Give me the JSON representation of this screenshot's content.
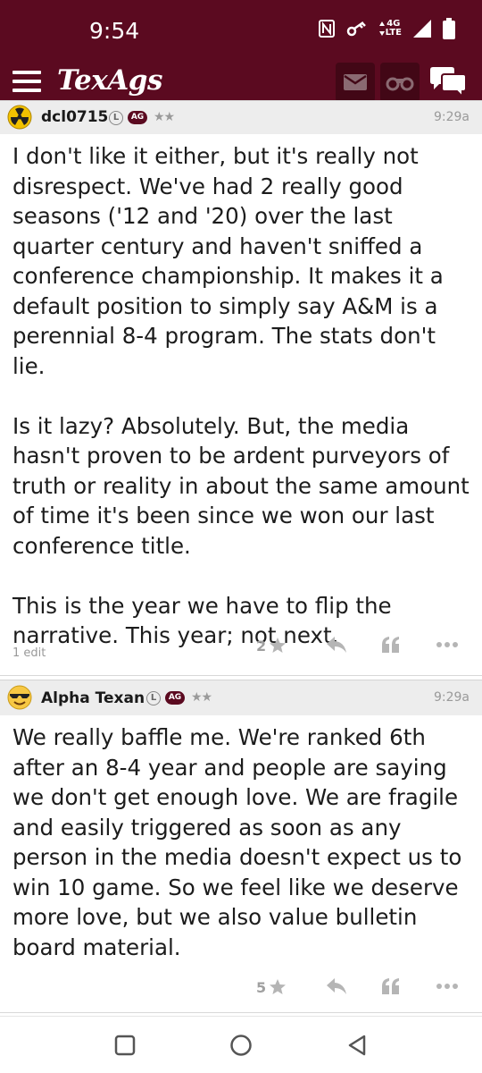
{
  "status_bar": {
    "time": "9:54",
    "network_top": "4G",
    "network_bottom": "LTE",
    "icons": [
      "nfc-icon",
      "vpn-key-icon",
      "signal-icon",
      "battery-icon"
    ]
  },
  "header": {
    "logo_text": "TexAgs",
    "buttons": [
      "mail-icon",
      "binoculars-icon",
      "chat-icon"
    ],
    "brand_color": "#5b0a20"
  },
  "posts": [
    {
      "username": "dcl0715",
      "badge_l": "L",
      "badge_ag": "AG",
      "stars": "★★",
      "time": "9:29a",
      "avatar": "radioactive-avatar",
      "paragraphs": [
        "I don't like it either, but it's really not disrespect. We've had 2 really good seasons ('12 and '20) over the last quarter century and haven't sniffed a conference championship. It makes it a default position to simply say A&M is a perennial 8-4 program. The stats don't lie.",
        "Is it lazy? Absolutely. But, the media hasn't proven to be ardent purveyors of truth or reality in about the same amount of time it's been since we won our last conference title.",
        "This is the year we have to flip the narrative. This year; not next."
      ],
      "edit_note": "1 edit",
      "rating": "2"
    },
    {
      "username": "Alpha Texan",
      "badge_l": "L",
      "badge_ag": "AG",
      "stars": "★★",
      "time": "9:29a",
      "avatar": "sunglasses-emoji-avatar",
      "paragraphs": [
        "We really baffle me. We're ranked 6th after an 8-4 year and people are saying we don't get enough love. We are fragile and easily triggered as soon as any person in the media doesn't expect us to win 10 game. So we feel like we deserve more love, but we also value bulletin board material."
      ],
      "rating": "5"
    }
  ],
  "nav_bar": [
    "recents-square-icon",
    "home-circle-icon",
    "back-triangle-icon"
  ]
}
